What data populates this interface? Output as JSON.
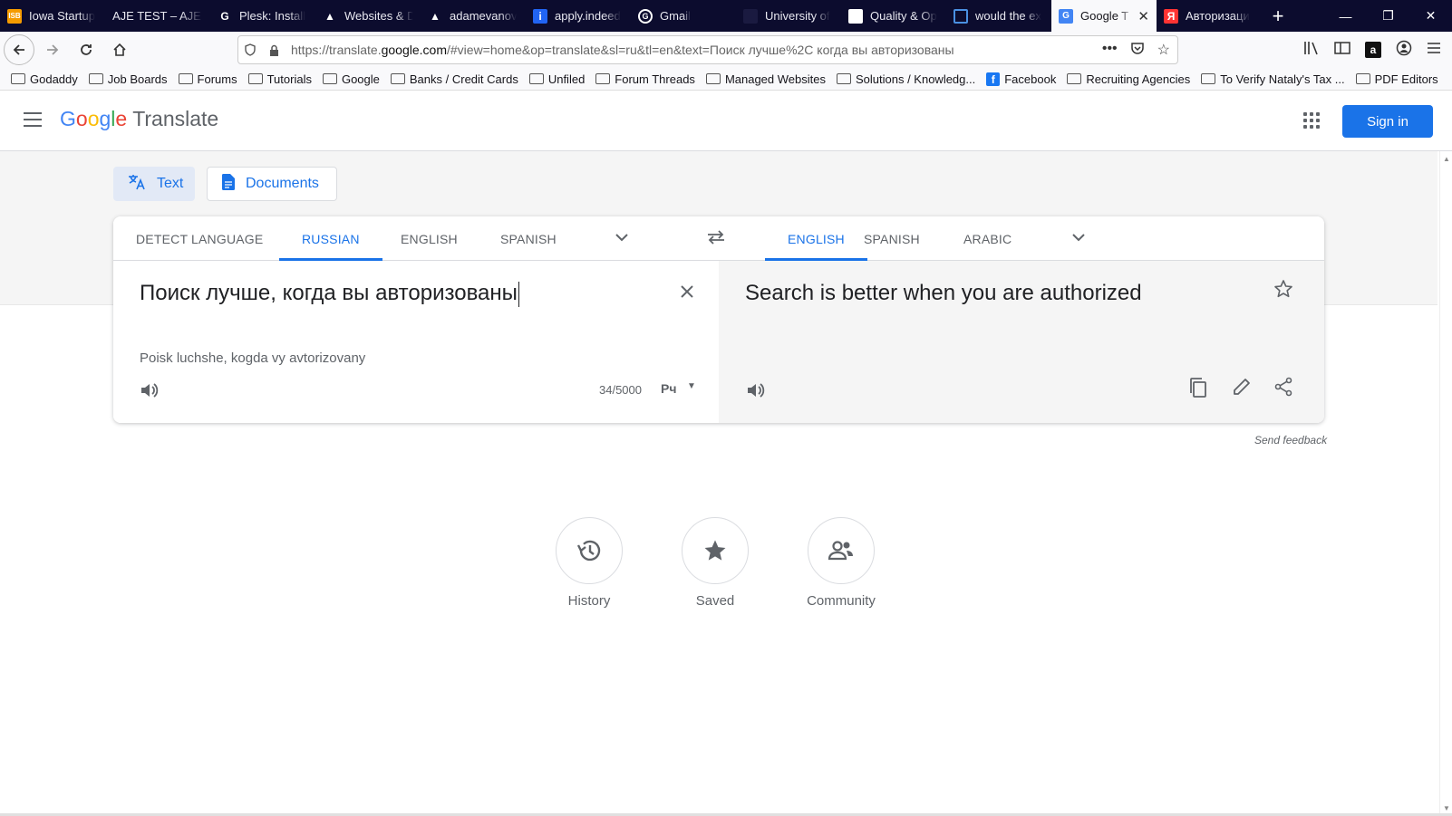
{
  "browser": {
    "tabs": [
      {
        "label": "Iowa Startup",
        "favicon": "iowa-icon",
        "favicon_color": "#f59b00"
      },
      {
        "label": "AJE TEST – AJE t",
        "favicon": "none",
        "favicon_color": ""
      },
      {
        "label": "Plesk: Install",
        "favicon": "plesk-icon",
        "favicon_color": "#ffffff"
      },
      {
        "label": "Websites & D",
        "favicon": "warning-icon",
        "favicon_color": "#ffffff"
      },
      {
        "label": "adamevanov",
        "favicon": "warning-icon",
        "favicon_color": "#ffffff"
      },
      {
        "label": "apply.indeed",
        "favicon": "indeed-icon",
        "favicon_color": "#2164f3"
      },
      {
        "label": "Gmail",
        "favicon": "google-icon",
        "favicon_color": "#ffffff"
      },
      {
        "label": "University of",
        "favicon": "university-icon",
        "favicon_color": "#1a1a40"
      },
      {
        "label": "Quality & Op",
        "favicon": "page-icon",
        "favicon_color": "#ffffff"
      },
      {
        "label": "would the ex",
        "favicon": "grid-icon",
        "favicon_color": "#4a90e2"
      },
      {
        "label": "Google T",
        "favicon": "translate-icon",
        "favicon_color": "#4285f4",
        "active": true
      },
      {
        "label": "Авторизаци",
        "favicon": "yandex-icon",
        "favicon_color": "#ff3333"
      }
    ],
    "url_prefix": "https://translate.",
    "url_domain": "google.com",
    "url_rest": "/#view=home&op=translate&sl=ru&tl=en&text=Поиск лучше%2C когда вы авторизованы",
    "bookmarks": [
      {
        "label": "Godaddy",
        "type": "folder"
      },
      {
        "label": "Job Boards",
        "type": "folder"
      },
      {
        "label": "Forums",
        "type": "folder"
      },
      {
        "label": "Tutorials",
        "type": "folder"
      },
      {
        "label": "Google",
        "type": "folder"
      },
      {
        "label": "Banks / Credit Cards",
        "type": "folder"
      },
      {
        "label": "Unfiled",
        "type": "folder"
      },
      {
        "label": "Forum Threads",
        "type": "folder"
      },
      {
        "label": "Managed Websites",
        "type": "folder"
      },
      {
        "label": "Solutions / Knowledg...",
        "type": "folder"
      },
      {
        "label": "Facebook",
        "type": "facebook"
      },
      {
        "label": "Recruiting Agencies",
        "type": "folder"
      },
      {
        "label": "To Verify Nataly's Tax ...",
        "type": "folder"
      },
      {
        "label": "PDF Editors",
        "type": "folder"
      }
    ]
  },
  "header": {
    "logo_letters": [
      "G",
      "o",
      "o",
      "g",
      "l",
      "e"
    ],
    "product": "Translate",
    "signin_label": "Sign in"
  },
  "modes": {
    "text_label": "Text",
    "documents_label": "Documents"
  },
  "source_langs": {
    "detect": "DETECT LANGUAGE",
    "items": [
      "RUSSIAN",
      "ENGLISH",
      "SPANISH"
    ],
    "selected": "RUSSIAN"
  },
  "target_langs": {
    "items": [
      "ENGLISH",
      "SPANISH",
      "ARABIC"
    ],
    "selected": "ENGLISH"
  },
  "source": {
    "text": "Поиск лучше, когда вы авторизованы",
    "transliteration": "Poisk luchshe, kogda vy avtorizovany",
    "char_count": "34/5000",
    "keyboard_label": "Рч"
  },
  "target": {
    "text": "Search is better when you are authorized"
  },
  "feedback_label": "Send feedback",
  "bottom": {
    "history_label": "History",
    "saved_label": "Saved",
    "community_label": "Community"
  },
  "colors": {
    "accent": "#1a73e8",
    "tab_bar": "#0c0c2e"
  }
}
